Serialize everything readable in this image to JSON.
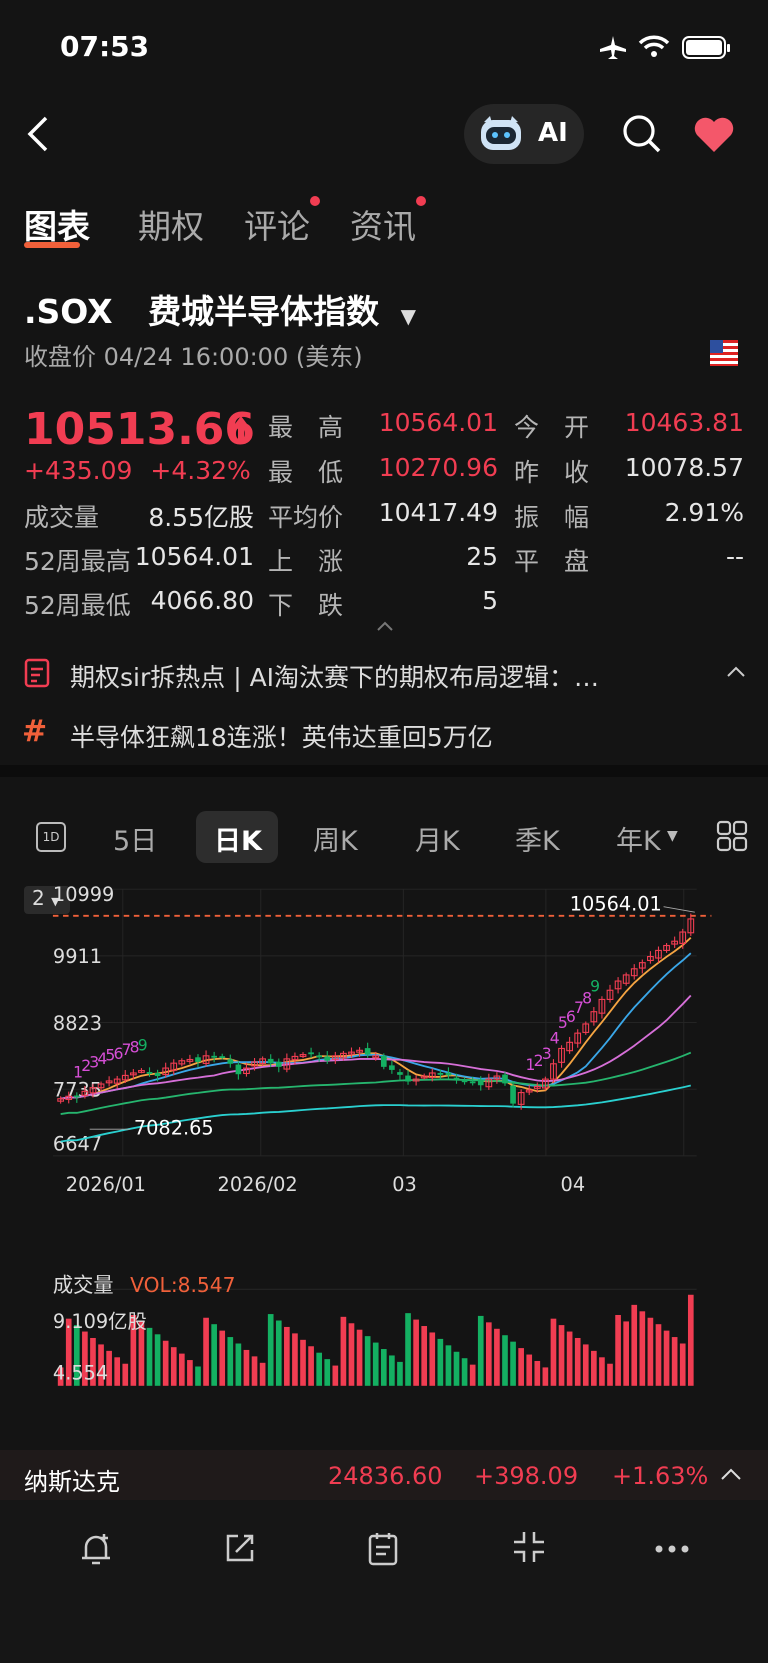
{
  "status": {
    "time": "07:53"
  },
  "header": {
    "ai_label": "AI"
  },
  "tabs": [
    {
      "label": "图表",
      "active": true,
      "dot": false
    },
    {
      "label": "期权",
      "active": false,
      "dot": false
    },
    {
      "label": "评论",
      "active": false,
      "dot": true
    },
    {
      "label": "资讯",
      "active": false,
      "dot": true
    }
  ],
  "stock": {
    "symbol": ".SOX",
    "name": "费城半导体指数",
    "close_info": "收盘价 04/24 16:00:00 (美东)",
    "price": "10513.66",
    "change": "+435.09",
    "change_pct": "+4.32%",
    "volume_label": "成交量",
    "volume": "8.55亿股",
    "wk52_high_label": "52周最高",
    "wk52_high": "10564.01",
    "wk52_low_label": "52周最低",
    "wk52_low": "4066.80",
    "high_label": "最　高",
    "high": "10564.01",
    "low_label": "最　低",
    "low": "10270.96",
    "avg_label": "平均价",
    "avg": "10417.49",
    "up_label": "上　涨",
    "up": "25",
    "down_label": "下　跌",
    "down": "5",
    "open_label": "今　开",
    "open": "10463.81",
    "prev_label": "昨　收",
    "prev": "10078.57",
    "amp_label": "振　幅",
    "amp": "2.91%",
    "flat_label": "平　盘",
    "flat": "--"
  },
  "news": [
    {
      "icon": "article-icon",
      "text": "期权sir拆热点 | AI淘汰赛下的期权布局逻辑：…"
    },
    {
      "icon": "hashtag-icon",
      "text": "半导体狂飙18连涨！英伟达重回5万亿"
    }
  ],
  "ktabs": [
    {
      "label": "5日",
      "active": false
    },
    {
      "label": "日K",
      "active": true
    },
    {
      "label": "周K",
      "active": false
    },
    {
      "label": "月K",
      "active": false
    },
    {
      "label": "季K",
      "active": false
    },
    {
      "label": "年K",
      "active": false
    }
  ],
  "ktab_1d": "1D",
  "chart_badge": "2",
  "chart_data": {
    "type": "candlestick",
    "y_ticks": [
      "10999",
      "9911",
      "8823",
      "7735",
      "6647"
    ],
    "x_ticks": [
      "2026/01",
      "2026/02",
      "03",
      "04"
    ],
    "max_label": "10564.01",
    "min_label": "7082.65",
    "close_series": [
      7580,
      7620,
      7600,
      7700,
      7760,
      7820,
      7870,
      7900,
      7960,
      8000,
      8040,
      8000,
      7950,
      8080,
      8160,
      8200,
      8220,
      8180,
      8280,
      8250,
      8260,
      8150,
      7980,
      8080,
      8180,
      8230,
      8160,
      8100,
      8230,
      8270,
      8300,
      8310,
      8270,
      8200,
      8280,
      8320,
      8340,
      8370,
      8300,
      8280,
      8100,
      8050,
      7970,
      7860,
      7900,
      7950,
      8000,
      7980,
      7960,
      7900,
      7850,
      7860,
      7800,
      7900,
      7950,
      7830,
      7500,
      7680,
      7720,
      7780,
      7900,
      8150,
      8400,
      8500,
      8650,
      8800,
      9000,
      9200,
      9350,
      9500,
      9600,
      9700,
      9800,
      9900,
      10000,
      10080,
      10150,
      10300,
      10513.66
    ],
    "volume_label": "成交量",
    "vol_value": "VOL:8.547",
    "vol_ticks": [
      "9.109亿股",
      "4.554"
    ]
  },
  "ticker": {
    "name": "纳斯达克",
    "price": "24836.60",
    "change": "+398.09",
    "pct": "+1.63%"
  }
}
